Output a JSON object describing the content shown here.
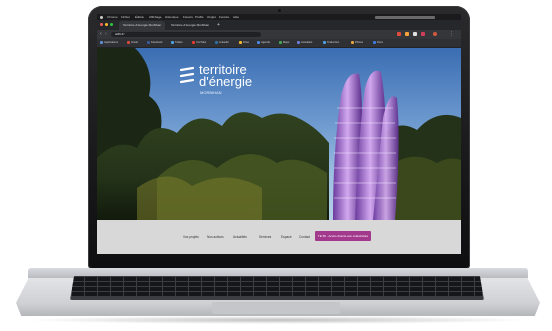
{
  "browser": {
    "menu_items": [
      "Chrome",
      "Fichier",
      "Édition",
      "Affichage",
      "Historique",
      "Favoris",
      "Profils",
      "Onglet",
      "Fenêtre",
      "Aide"
    ],
    "tabs": [
      {
        "label": "Territoire d'énergie Morbihan"
      },
      {
        "label": "Territoire d'énergie Morbihan"
      }
    ],
    "address": "te56.fr/",
    "bookmarks": [
      {
        "label": "Applications",
        "color": "#5f8dd3"
      },
      {
        "label": "Gmail",
        "color": "#d64b3c"
      },
      {
        "label": "Facebook",
        "color": "#3b5998"
      },
      {
        "label": "Twitter",
        "color": "#4aa3df"
      },
      {
        "label": "YouTube",
        "color": "#e33b2e"
      },
      {
        "label": "LinkedIn",
        "color": "#2f6fa3"
      },
      {
        "label": "Drive",
        "color": "#f1b532"
      },
      {
        "label": "Agenda",
        "color": "#4b86e1"
      },
      {
        "label": "Maps",
        "color": "#43a356"
      },
      {
        "label": "Actualités",
        "color": "#6c7ad8"
      },
      {
        "label": "Traduction",
        "color": "#4f9ee8"
      },
      {
        "label": "Photos",
        "color": "#e6a23c"
      },
      {
        "label": "Docs",
        "color": "#3d7be0"
      }
    ]
  },
  "site": {
    "logo_line1": "territoire",
    "logo_line2": "d'énergie",
    "logo_sub": "MORBIHAN",
    "nav": [
      "Vos projets",
      "Nos actions",
      "Actualités",
      "Services",
      "Espace",
      "Contact"
    ],
    "cta": "TE 56 · Accès directs aux collectivités"
  },
  "colors": {
    "accent": "#a3398d",
    "nav_bg": "#d8d8d8"
  }
}
